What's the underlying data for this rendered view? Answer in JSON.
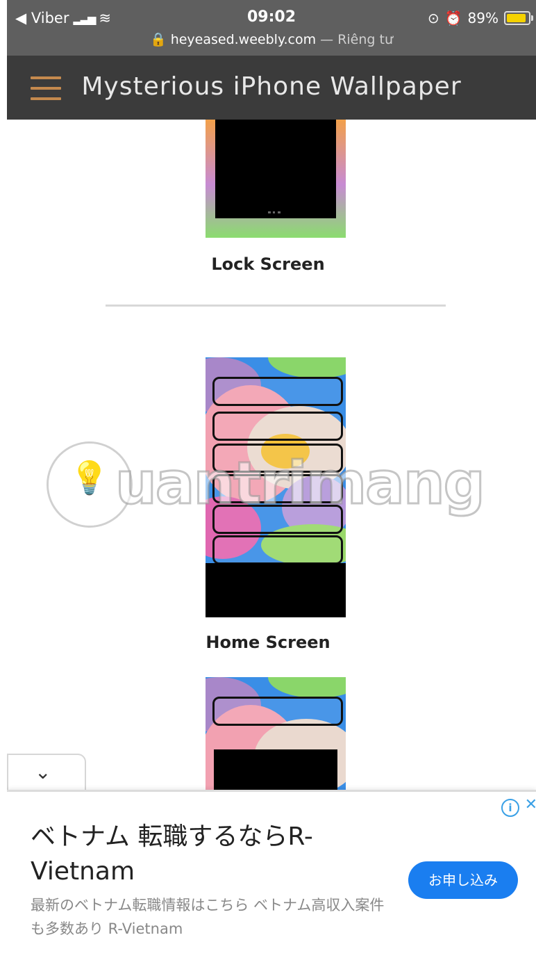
{
  "status_bar": {
    "back_app": "◀ Viber",
    "time": "09:02",
    "battery": "89%",
    "battery_level": 0.89,
    "lock_icon": "lock-icon",
    "url": "heyeased.weebly.com",
    "url_separator": " — ",
    "url_privacy": "Riêng tư"
  },
  "header": {
    "title": "Mysterious  iPhone  Wallpaper",
    "menu_icon": "hamburger-menu-icon",
    "menu_color": "#c58a4e"
  },
  "content": {
    "lock_caption": "Lock Screen",
    "home_caption": "Home Screen"
  },
  "watermark": {
    "text": "uantrimang",
    "icon": "lightbulb-icon"
  },
  "ad": {
    "collapse_icon": "chevron-down-icon",
    "info_icon": "info-icon",
    "close_icon": "close-icon",
    "title": "ベトナム 転職するならR-Vietnam",
    "description": "最新のベトナム転職情報はこちら ベトナム高収入案件も多数あり R-Vietnam",
    "cta": "お申し込み",
    "cta_color": "#1a7ef0"
  }
}
